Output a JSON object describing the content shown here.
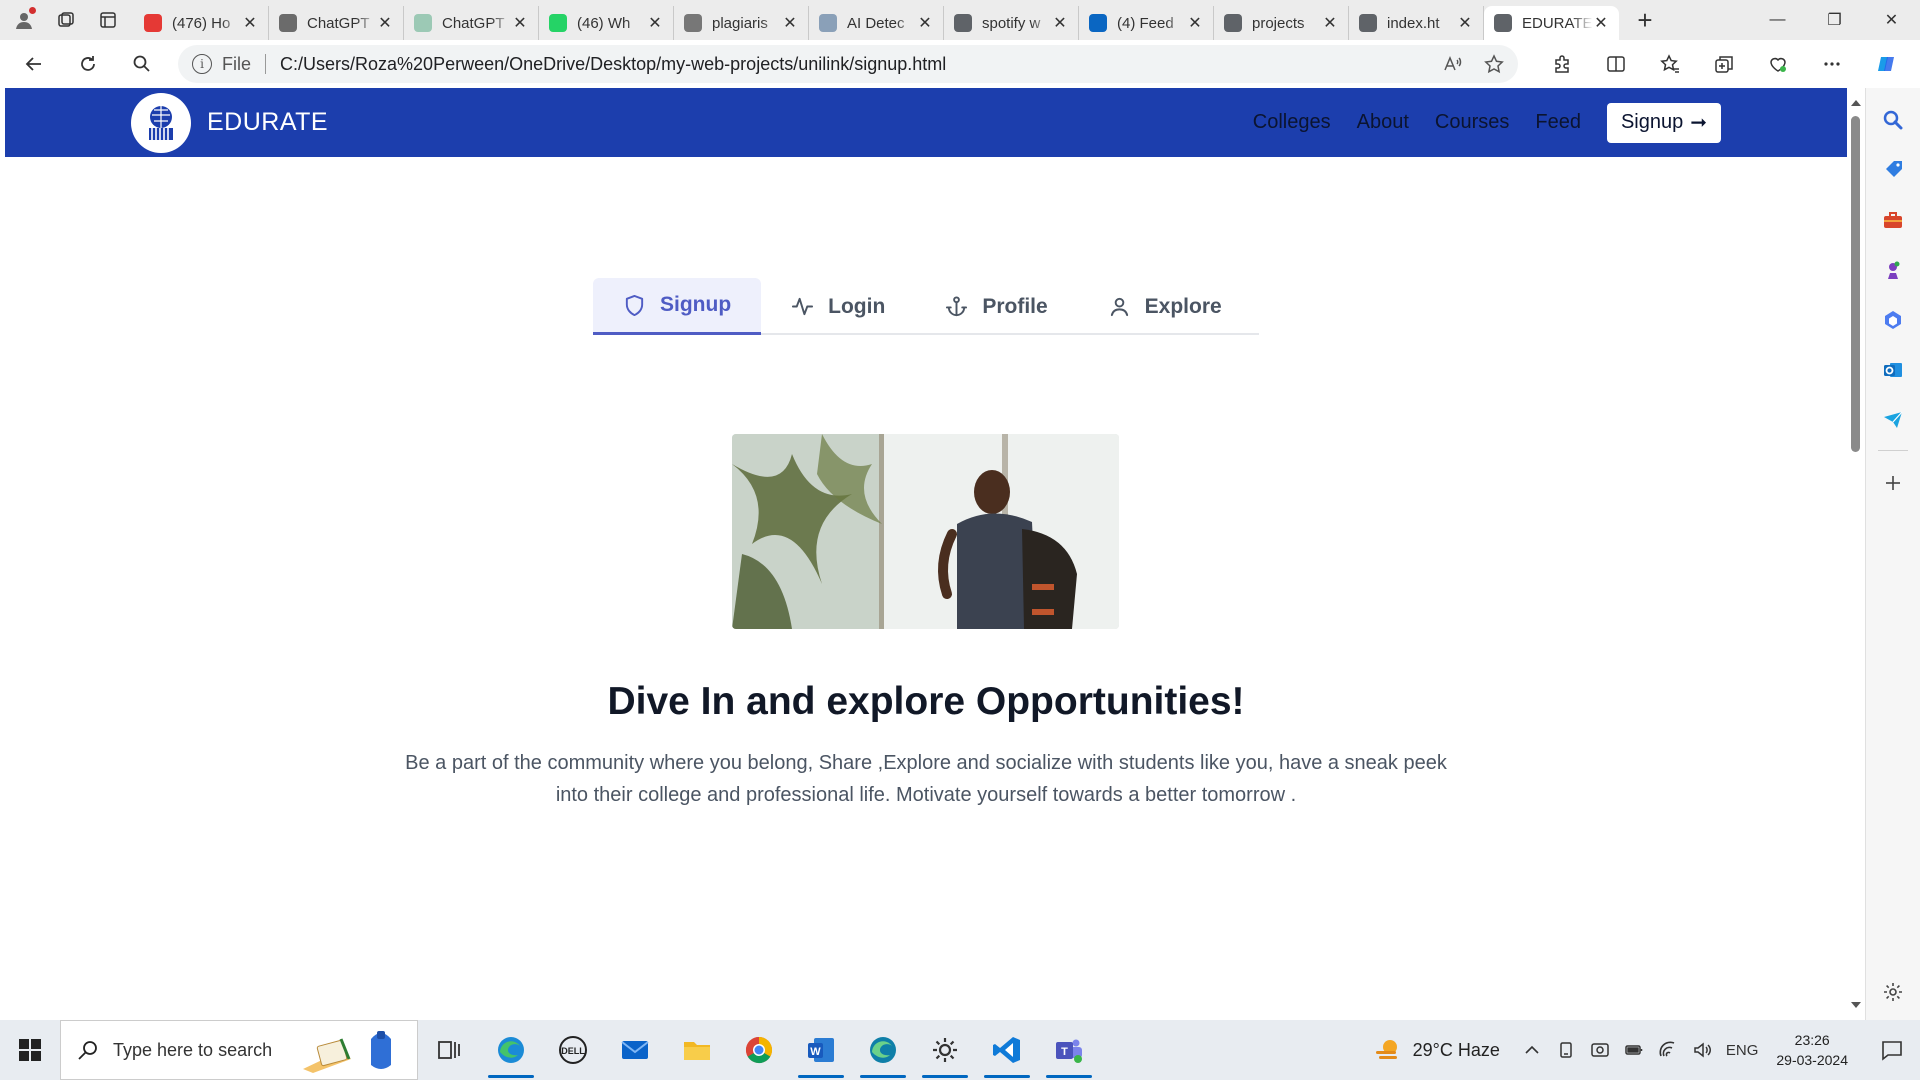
{
  "browser": {
    "tabs": [
      {
        "title": "(476) Ho",
        "favicon_color": "#e53935",
        "icon": "youtube-icon"
      },
      {
        "title": "ChatGPT",
        "favicon_color": "#6b6b6b",
        "icon": "chatgpt-icon"
      },
      {
        "title": "ChatGPT",
        "favicon_color": "#9cc9b5",
        "icon": "chatgpt-icon"
      },
      {
        "title": "(46) Wh",
        "favicon_color": "#25d366",
        "icon": "whatsapp-icon"
      },
      {
        "title": "plagiaris",
        "favicon_color": "#777777",
        "icon": "link-icon"
      },
      {
        "title": "AI Detec",
        "favicon_color": "#8aa0b8",
        "icon": "globe-icon"
      },
      {
        "title": "spotify w",
        "favicon_color": "#5f6368",
        "icon": "search-icon"
      },
      {
        "title": "(4) Feed",
        "favicon_color": "#0a66c2",
        "icon": "linkedin-icon"
      },
      {
        "title": "projects",
        "favicon_color": "#5f6368",
        "icon": "file-icon"
      },
      {
        "title": "index.ht",
        "favicon_color": "#5f6368",
        "icon": "file-icon"
      },
      {
        "title": "EDURATE",
        "favicon_color": "#5f6368",
        "icon": "file-icon",
        "active": true
      }
    ],
    "address": {
      "scheme_label": "File",
      "url": "C:/Users/Roza%20Perween/OneDrive/Desktop/my-web-projects/unilink/signup.html"
    }
  },
  "site": {
    "brand": "EDURATE",
    "nav": [
      "Colleges",
      "About",
      "Courses",
      "Feed"
    ],
    "cta": "Signup",
    "accent": "#1c3ead",
    "tabs": [
      {
        "label": "Signup",
        "icon": "shield-icon",
        "active": true
      },
      {
        "label": "Login",
        "icon": "activity-icon"
      },
      {
        "label": "Profile",
        "icon": "anchor-icon"
      },
      {
        "label": "Explore",
        "icon": "user-icon"
      }
    ],
    "headline": "Dive In and explore Opportunities!",
    "lead_line1": "Be a part of the community where you belong, Share ,Explore and socialize with students like you, have a sneak peek",
    "lead_line2": "into their college and professional life. Motivate yourself towards a better tomorrow ."
  },
  "taskbar": {
    "search_placeholder": "Type here to search",
    "weather": "29°C  Haze",
    "language": "ENG",
    "time": "23:26",
    "date": "29-03-2024"
  }
}
